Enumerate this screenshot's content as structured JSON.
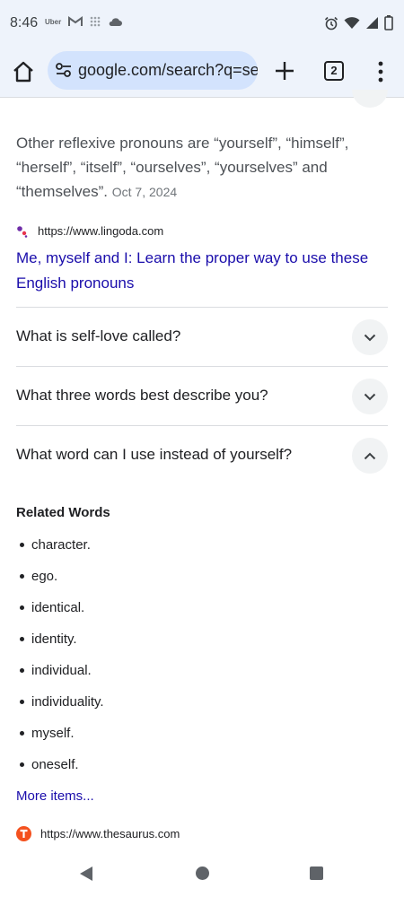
{
  "status_bar": {
    "time": "8:46",
    "notif_uber": "Uber",
    "icons_left": [
      "gmail-icon",
      "grid-icon",
      "cloud-icon"
    ],
    "icons_right": [
      "alarm-icon",
      "wifi-icon",
      "signal-icon",
      "battery-icon"
    ]
  },
  "toolbar": {
    "url": "google.com/search?q=se",
    "tab_count": "2"
  },
  "snippet": {
    "text": "Other reflexive pronouns are “yourself”, “himself”, “herself”, “itself”, “ourselves”, “yourselves” and “themselves”.",
    "date": "Oct 7, 2024"
  },
  "result": {
    "source_url": "https://www.lingoda.com",
    "title": "Me, myself and I: Learn the proper way to use these English pronouns"
  },
  "faqs": [
    {
      "question": "What is self-love called?",
      "expanded": false
    },
    {
      "question": "What three words best describe you?",
      "expanded": false
    },
    {
      "question": "What word can I use instead of yourself?",
      "expanded": true
    }
  ],
  "related": {
    "title": "Related Words",
    "items": [
      "character.",
      "ego.",
      "identical.",
      "identity.",
      "individual.",
      "individuality.",
      "myself.",
      "oneself."
    ],
    "more_label": "More items..."
  },
  "next_source_url": "https://www.thesaurus.com",
  "colors": {
    "link": "#1a0dab",
    "toolbar_bg": "#eef3fb",
    "urlbar_bg": "#d3e3fd",
    "chip_bg": "#f1f3f4"
  }
}
